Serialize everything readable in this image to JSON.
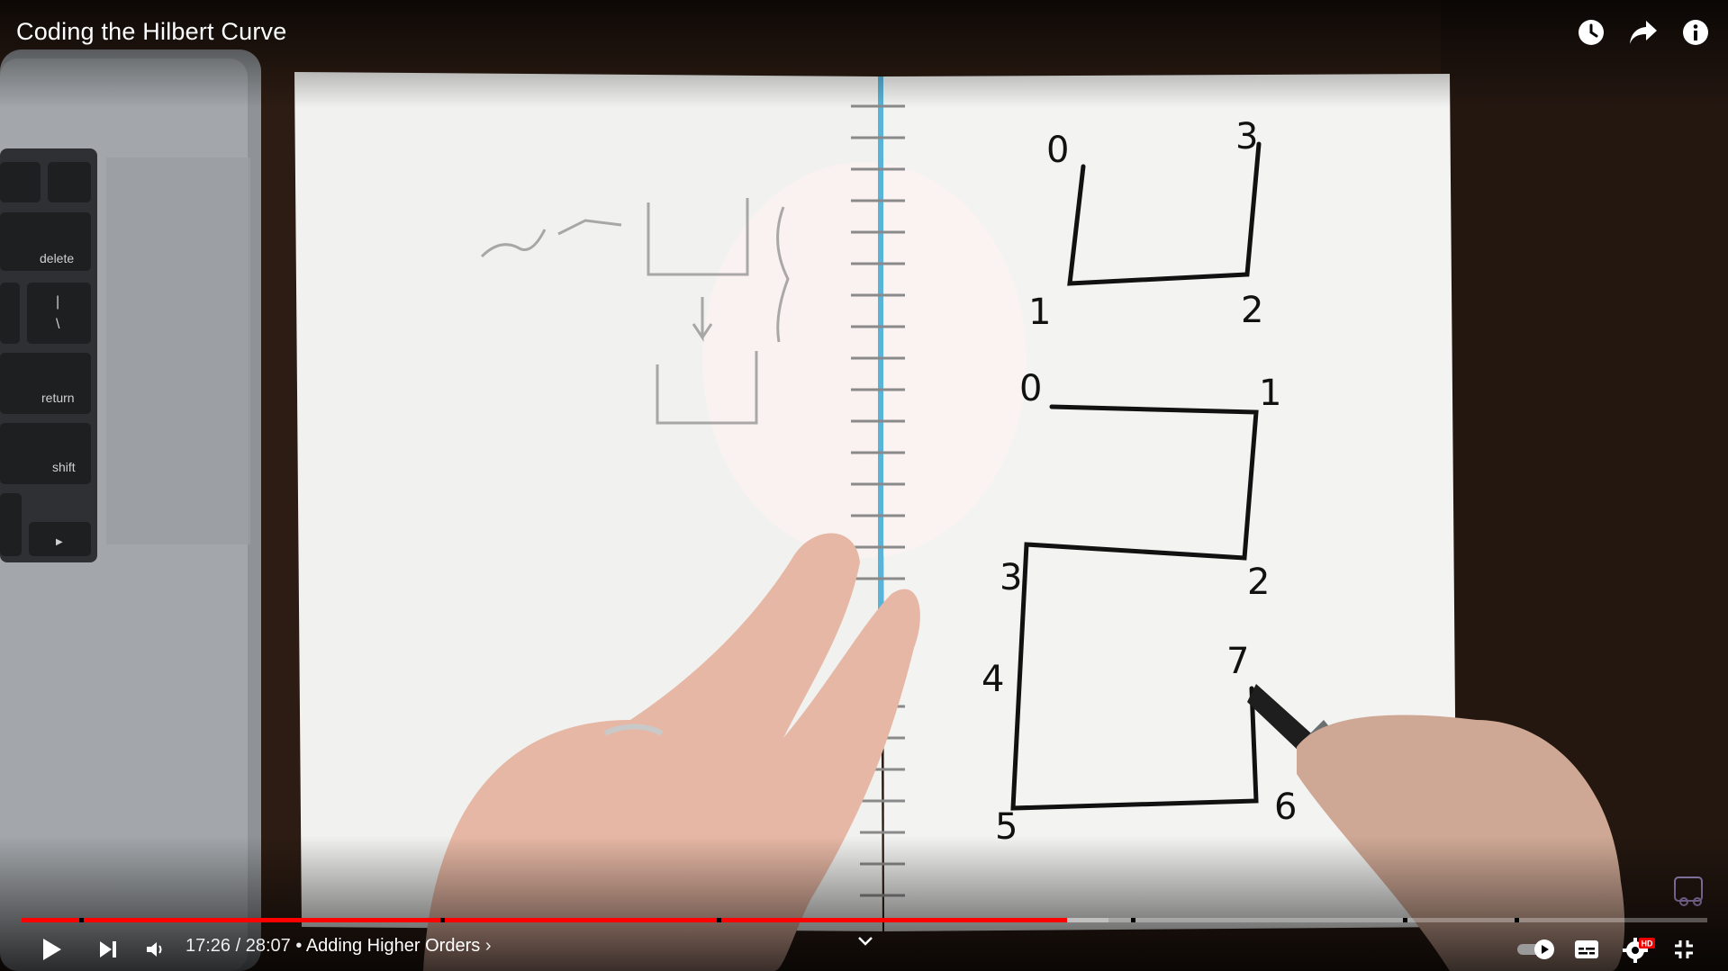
{
  "player": {
    "title": "Coding the Hilbert Curve",
    "current_time": "17:26",
    "separator": " / ",
    "duration": "28:07",
    "chapter_separator": " • ",
    "chapter": "Adding Higher Orders",
    "chapter_chevron": "›",
    "progress_fraction": 0.62,
    "buffered_fraction": 0.645
  },
  "top_icons": [
    "watch-later-icon",
    "share-icon",
    "info-icon"
  ],
  "bottom_icons": [
    "play-icon",
    "next-icon",
    "volume-icon",
    "autoplay-toggle",
    "captions-icon",
    "settings-icon",
    "fullscreen-exit-icon"
  ],
  "settings_badge": "HD",
  "keyboard_keys": {
    "delete": "delete",
    "return": "return",
    "shift": "shift",
    "backslash_top": "|",
    "backslash_bottom": "\\",
    "arrow": "▶"
  },
  "notebook": {
    "top_shape_labels": [
      "0",
      "3",
      "1",
      "2"
    ],
    "bottom_shape_labels": [
      "0",
      "1",
      "3",
      "2",
      "4",
      "7",
      "5",
      "6"
    ]
  },
  "colors": {
    "progress_played": "#ff0000",
    "progress_buffered": "#c0c0c0",
    "progress_unplayed": "rgba(255,255,255,0.3)",
    "text": "#ffffff"
  }
}
